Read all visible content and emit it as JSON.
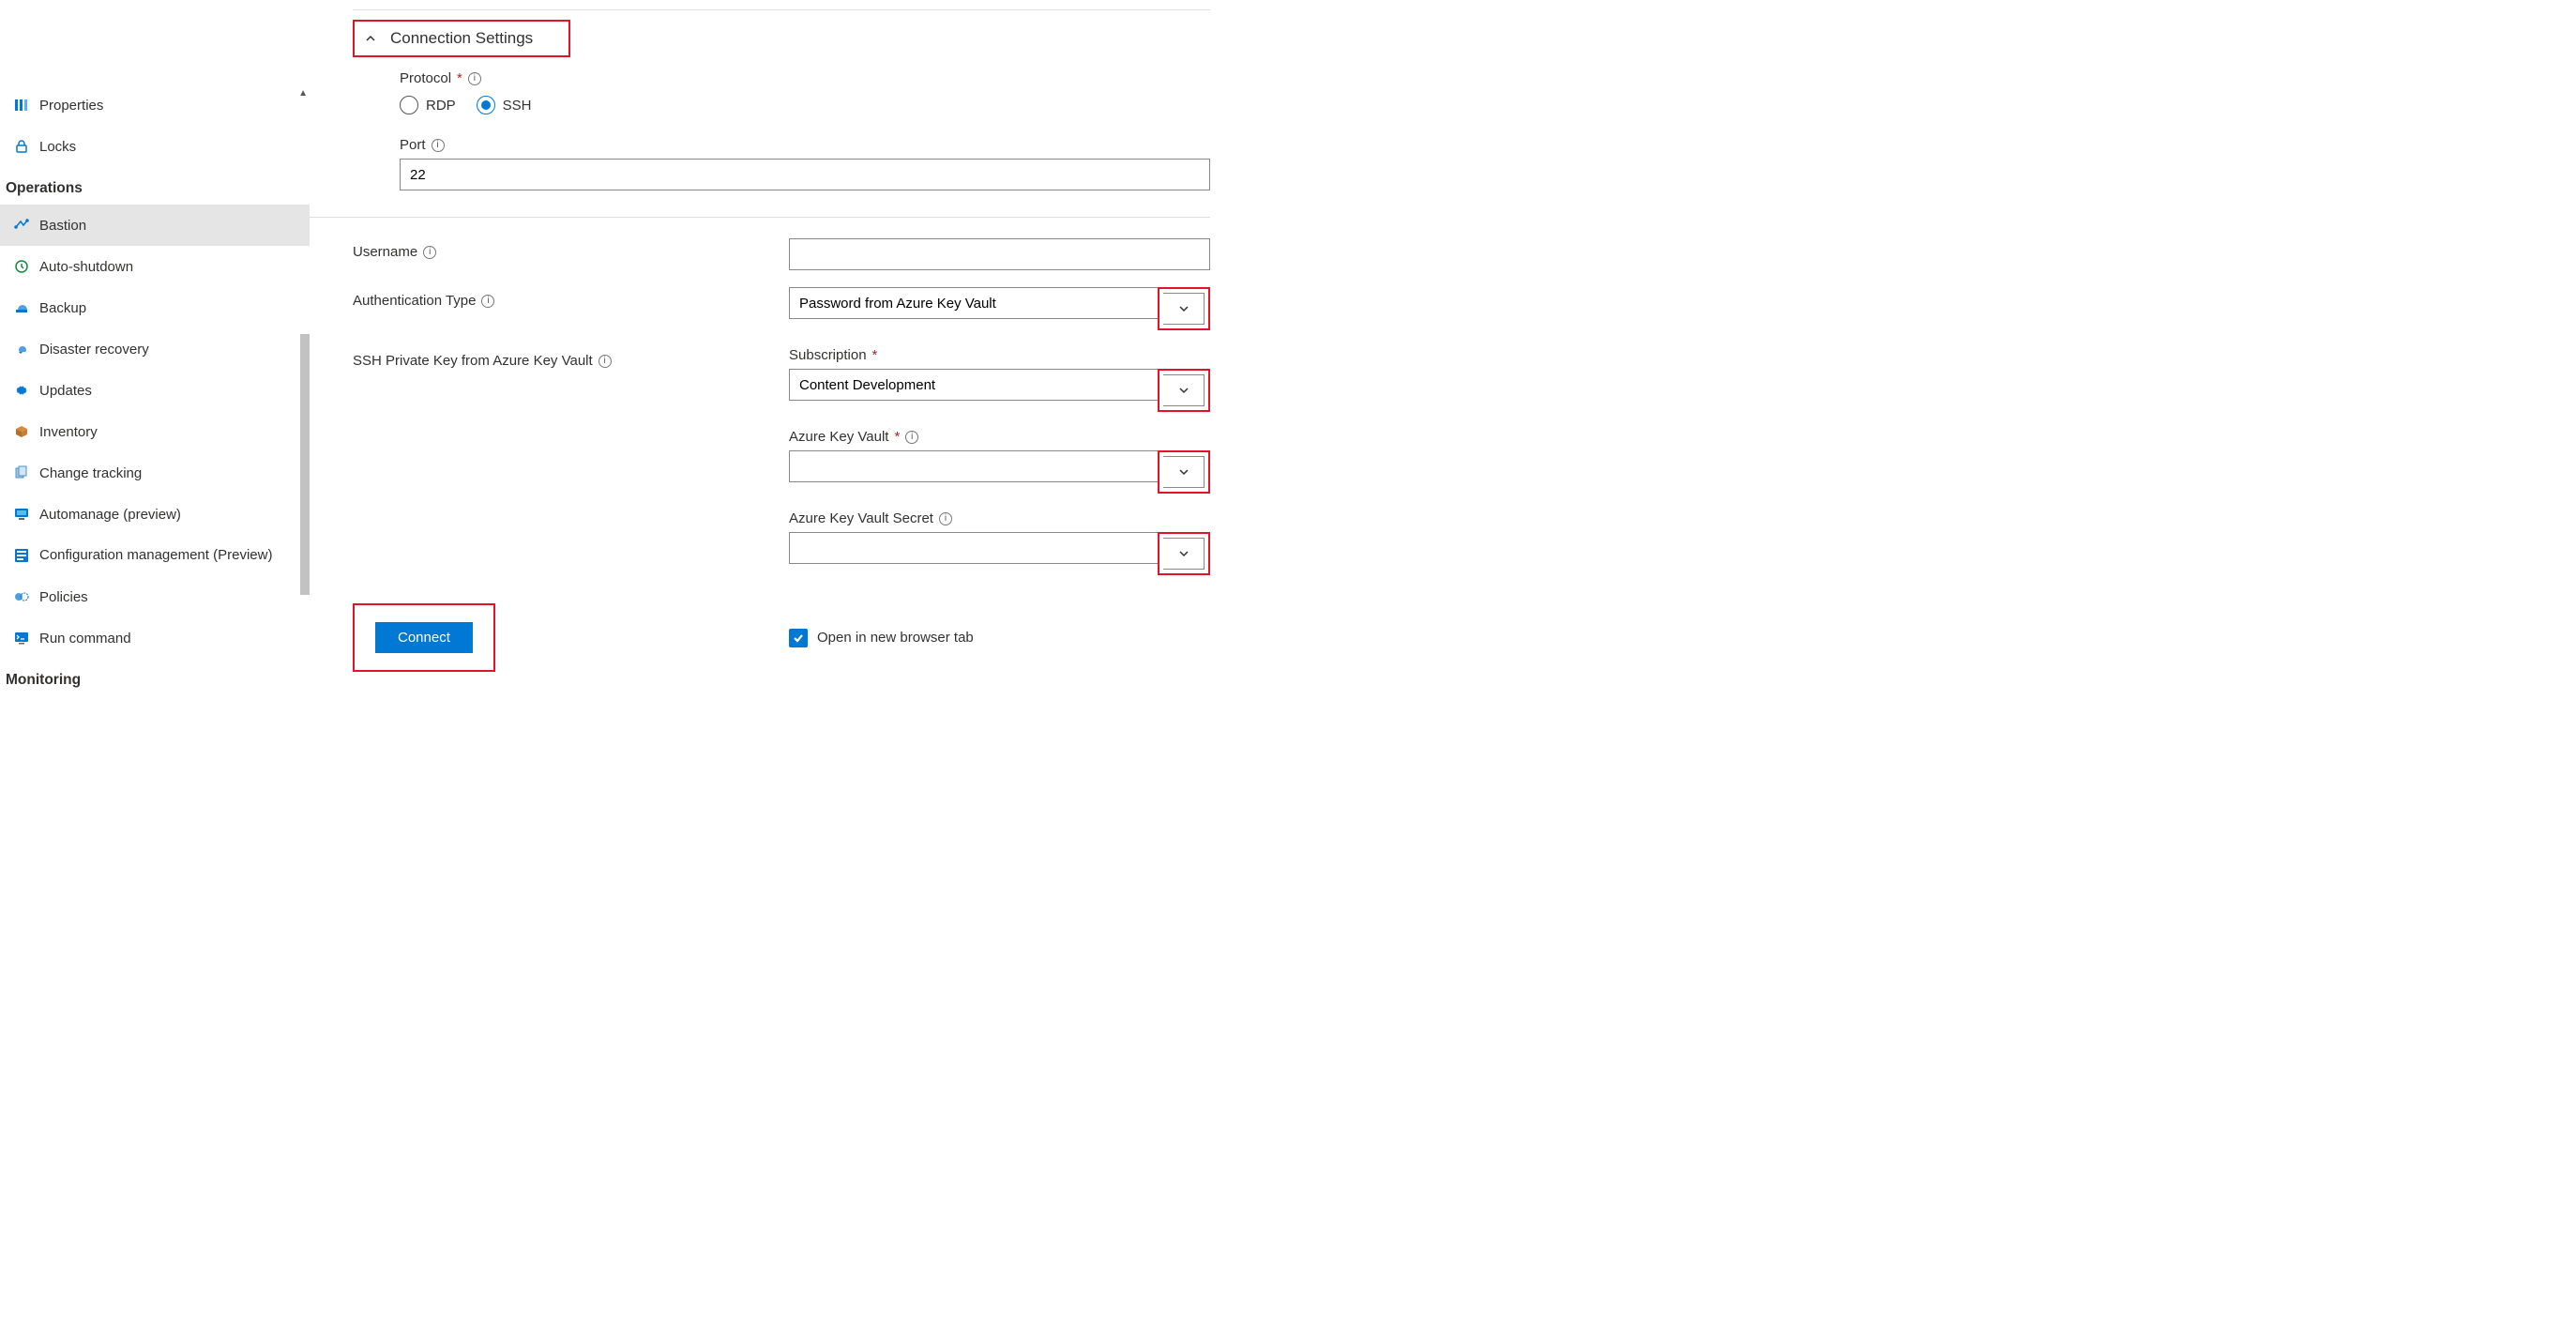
{
  "sidebar": {
    "top_items": [
      {
        "label": "Properties"
      },
      {
        "label": "Locks"
      }
    ],
    "section1_heading": "Operations",
    "section1_items": [
      {
        "label": "Bastion",
        "selected": true
      },
      {
        "label": "Auto-shutdown"
      },
      {
        "label": "Backup"
      },
      {
        "label": "Disaster recovery"
      },
      {
        "label": "Updates"
      },
      {
        "label": "Inventory"
      },
      {
        "label": "Change tracking"
      },
      {
        "label": "Automanage (preview)"
      },
      {
        "label": "Configuration management (Preview)"
      },
      {
        "label": "Policies"
      },
      {
        "label": "Run command"
      }
    ],
    "section2_heading": "Monitoring"
  },
  "main": {
    "section_title": "Connection Settings",
    "protocol_label": "Protocol",
    "protocol_options": {
      "rdp": "RDP",
      "ssh": "SSH"
    },
    "protocol_selected": "ssh",
    "port_label": "Port",
    "port_value": "22",
    "username_label": "Username",
    "username_value": "",
    "authtype_label": "Authentication Type",
    "authtype_value": "Password from Azure Key Vault",
    "sshkey_label": "SSH Private Key from Azure Key Vault",
    "subscription_label": "Subscription",
    "subscription_value": "Content Development",
    "akv_label": "Azure Key Vault",
    "akv_value": "",
    "akvs_label": "Azure Key Vault Secret",
    "akvs_value": "",
    "connect_label": "Connect",
    "newtab_label": "Open in new browser tab"
  }
}
